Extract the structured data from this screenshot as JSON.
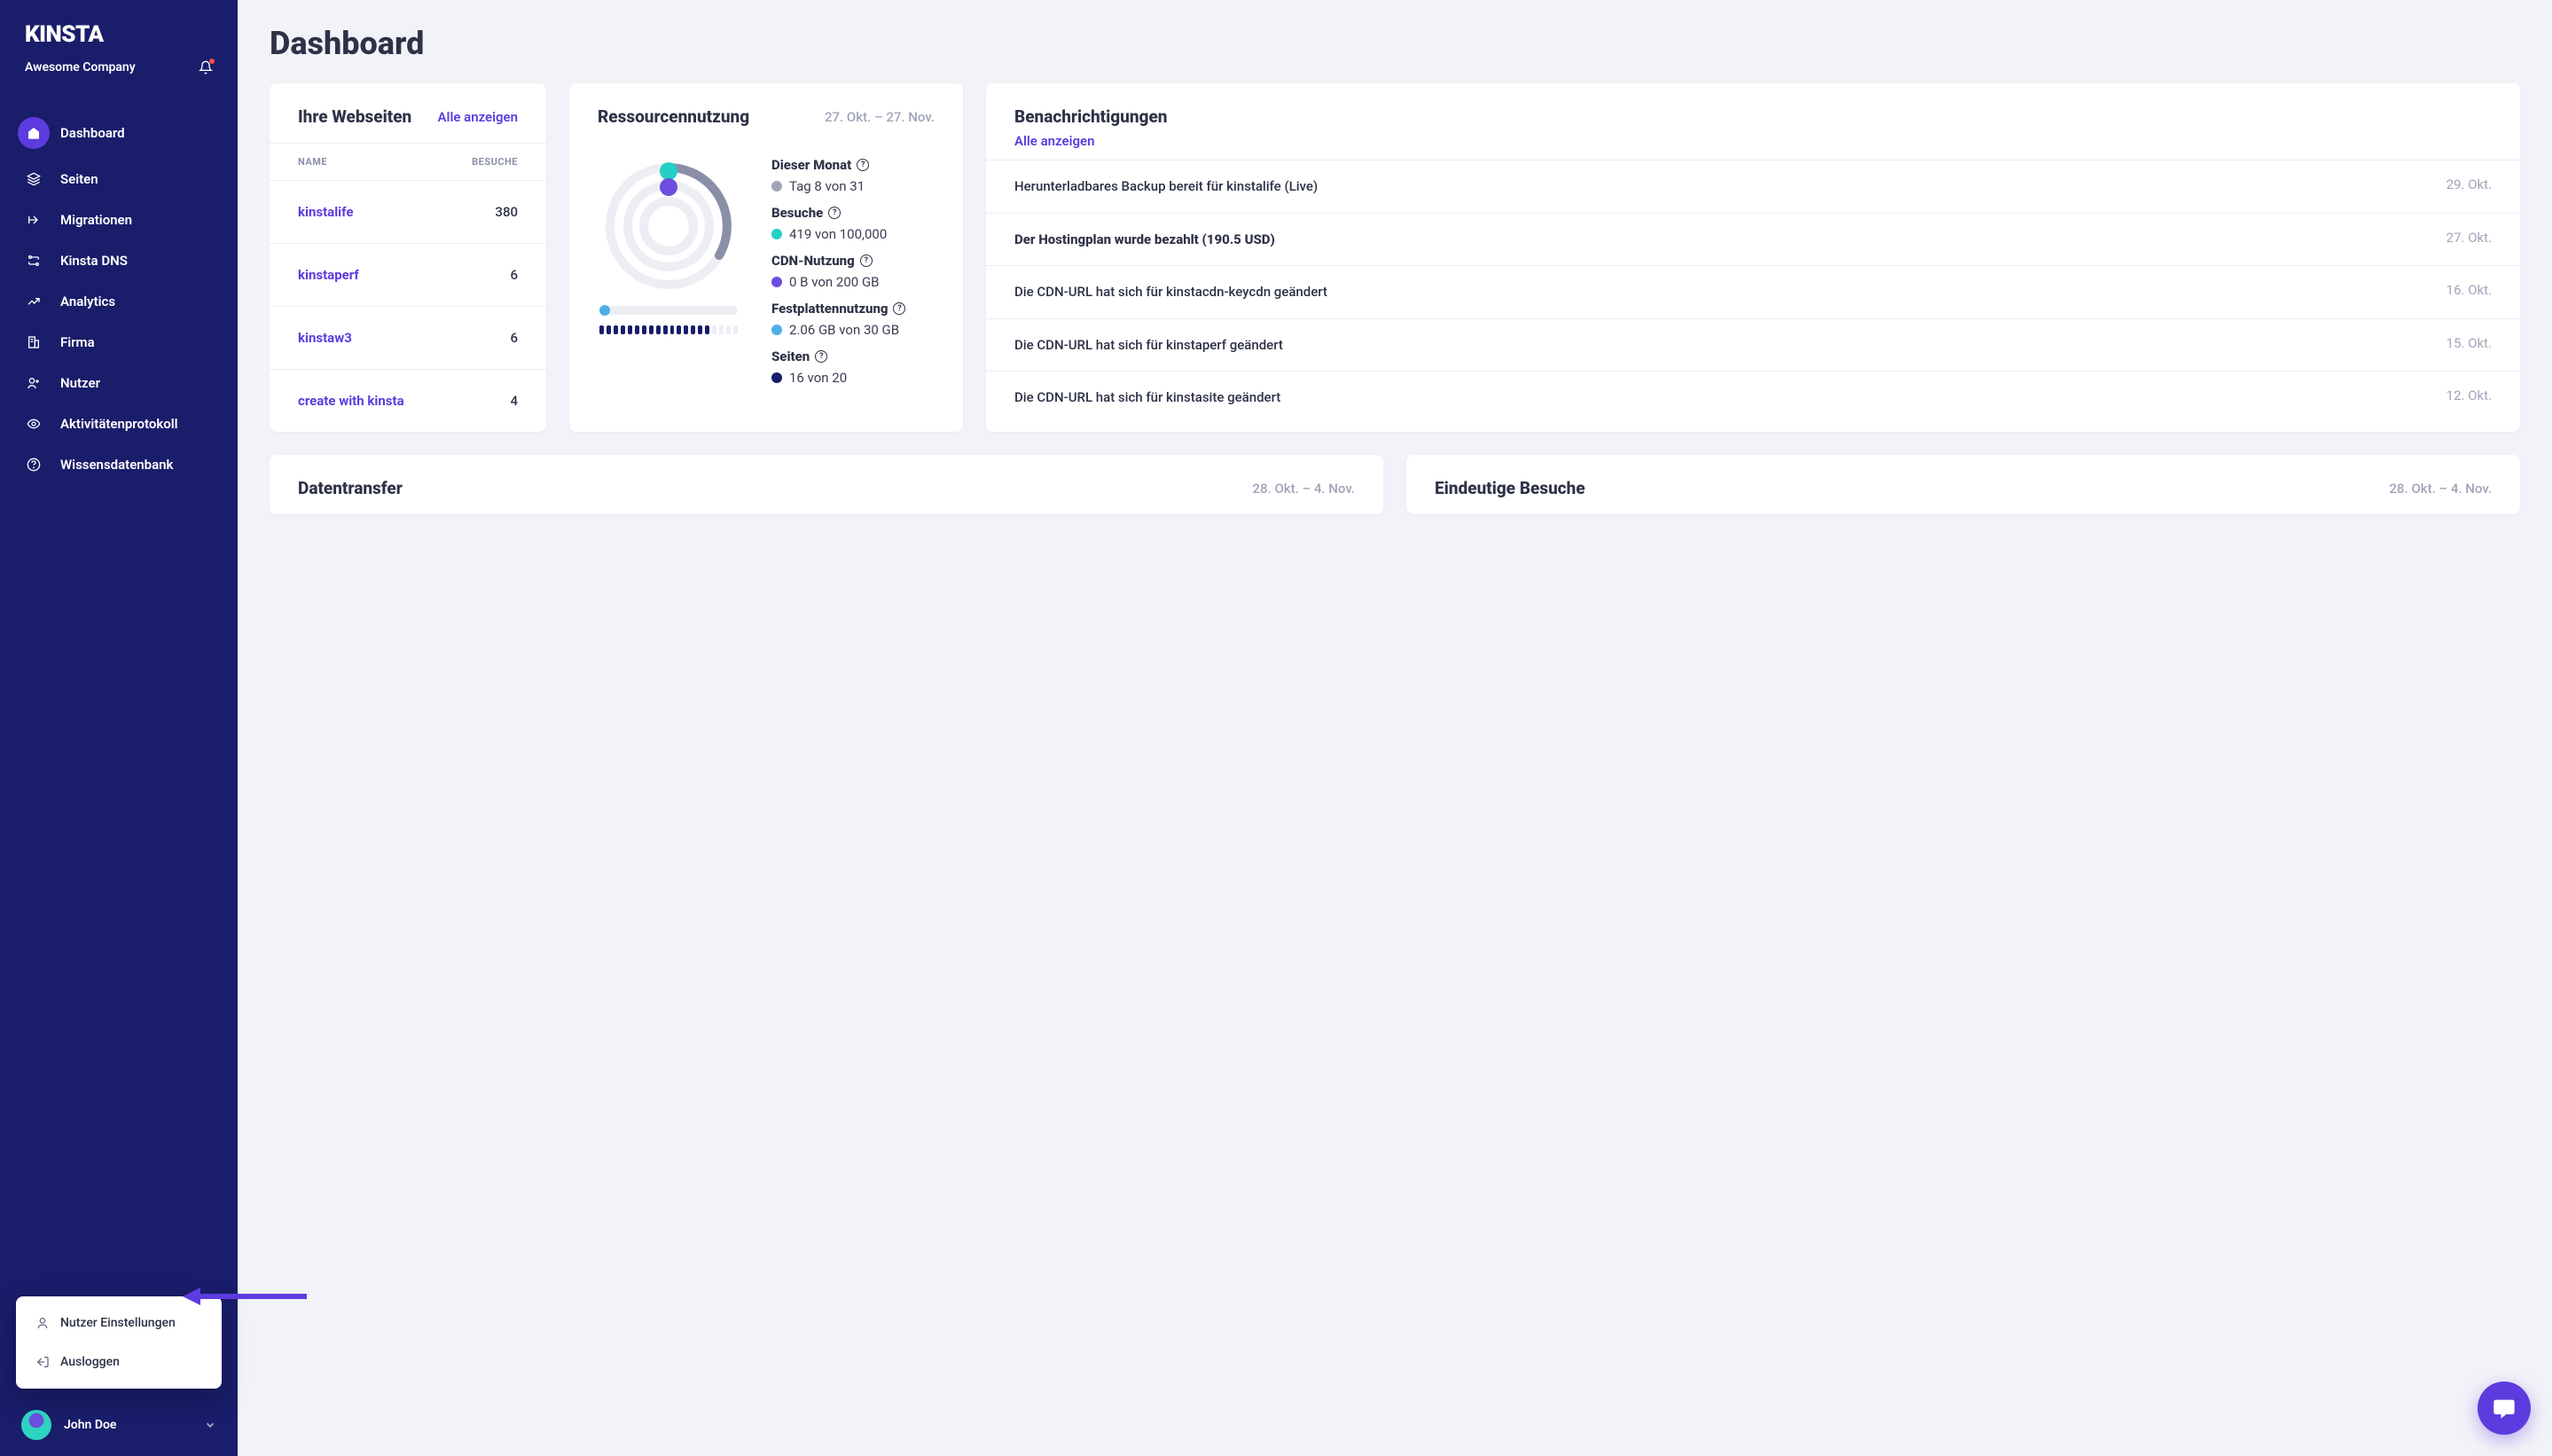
{
  "brand": "KINSTA",
  "company": "Awesome Company",
  "page_title": "Dashboard",
  "nav": [
    {
      "icon": "home",
      "label": "Dashboard"
    },
    {
      "icon": "layers",
      "label": "Seiten"
    },
    {
      "icon": "migrate",
      "label": "Migrationen"
    },
    {
      "icon": "dns",
      "label": "Kinsta DNS"
    },
    {
      "icon": "chart",
      "label": "Analytics"
    },
    {
      "icon": "building",
      "label": "Firma"
    },
    {
      "icon": "user-plus",
      "label": "Nutzer"
    },
    {
      "icon": "eye",
      "label": "Aktivitätenprotokoll"
    },
    {
      "icon": "help",
      "label": "Wissensdatenbank"
    }
  ],
  "user_popup": {
    "settings": "Nutzer Einstellungen",
    "logout": "Ausloggen"
  },
  "user_footer": {
    "name": "John Doe"
  },
  "sites_card": {
    "title": "Ihre Webseiten",
    "link": "Alle anzeigen",
    "col_name": "NAME",
    "col_visits": "BESUCHE",
    "rows": [
      {
        "name": "kinstalife",
        "visits": "380"
      },
      {
        "name": "kinstaperf",
        "visits": "6"
      },
      {
        "name": "kinstaw3",
        "visits": "6"
      },
      {
        "name": "create with kinsta",
        "visits": "4"
      }
    ]
  },
  "resource_card": {
    "title": "Ressourcennutzung",
    "date_range": "27. Okt. – 27. Nov.",
    "metrics": {
      "month_label": "Dieser Monat",
      "month_value": "Tag 8 von 31",
      "visits_label": "Besuche",
      "visits_value": "419 von 100,000",
      "cdn_label": "CDN-Nutzung",
      "cdn_value": "0 B von 200 GB",
      "disk_label": "Festplattennutzung",
      "disk_value": "2.06 GB von 30 GB",
      "sites_label": "Seiten",
      "sites_value": "16 von 20"
    }
  },
  "notifications_card": {
    "title": "Benachrichtigungen",
    "link": "Alle anzeigen",
    "items": [
      {
        "text": "Herunterladbares Backup bereit für kinstalife (Live)",
        "date": "29. Okt.",
        "bold": false
      },
      {
        "text": "Der Hostingplan wurde bezahlt (190.5 USD)",
        "date": "27. Okt.",
        "bold": true
      },
      {
        "text": "Die CDN-URL hat sich für kinstacdn-keycdn geändert",
        "date": "16. Okt.",
        "bold": false
      },
      {
        "text": "Die CDN-URL hat sich für kinstaperf geändert",
        "date": "15. Okt.",
        "bold": false
      },
      {
        "text": "Die CDN-URL hat sich für kinstasite geändert",
        "date": "12. Okt.",
        "bold": false
      }
    ]
  },
  "bottom_cards": {
    "transfer_title": "Datentransfer",
    "transfer_date": "28. Okt. – 4. Nov.",
    "unique_title": "Eindeutige Besuche",
    "unique_date": "28. Okt. – 4. Nov."
  },
  "chart_data": {
    "type": "gauge",
    "title": "Ressourcennutzung",
    "series": [
      {
        "name": "Dieser Monat",
        "value": 8,
        "max": 31,
        "unit": "Tag"
      },
      {
        "name": "Besuche",
        "value": 419,
        "max": 100000
      },
      {
        "name": "CDN-Nutzung",
        "value": 0,
        "max": 200,
        "unit": "GB"
      },
      {
        "name": "Festplattennutzung",
        "value": 2.06,
        "max": 30,
        "unit": "GB"
      },
      {
        "name": "Seiten",
        "value": 16,
        "max": 20
      }
    ]
  },
  "colors": {
    "brand_sidebar": "#1a1d6a",
    "accent": "#5c3cdf",
    "teal": "#24cfc5",
    "blue": "#4faee8"
  }
}
